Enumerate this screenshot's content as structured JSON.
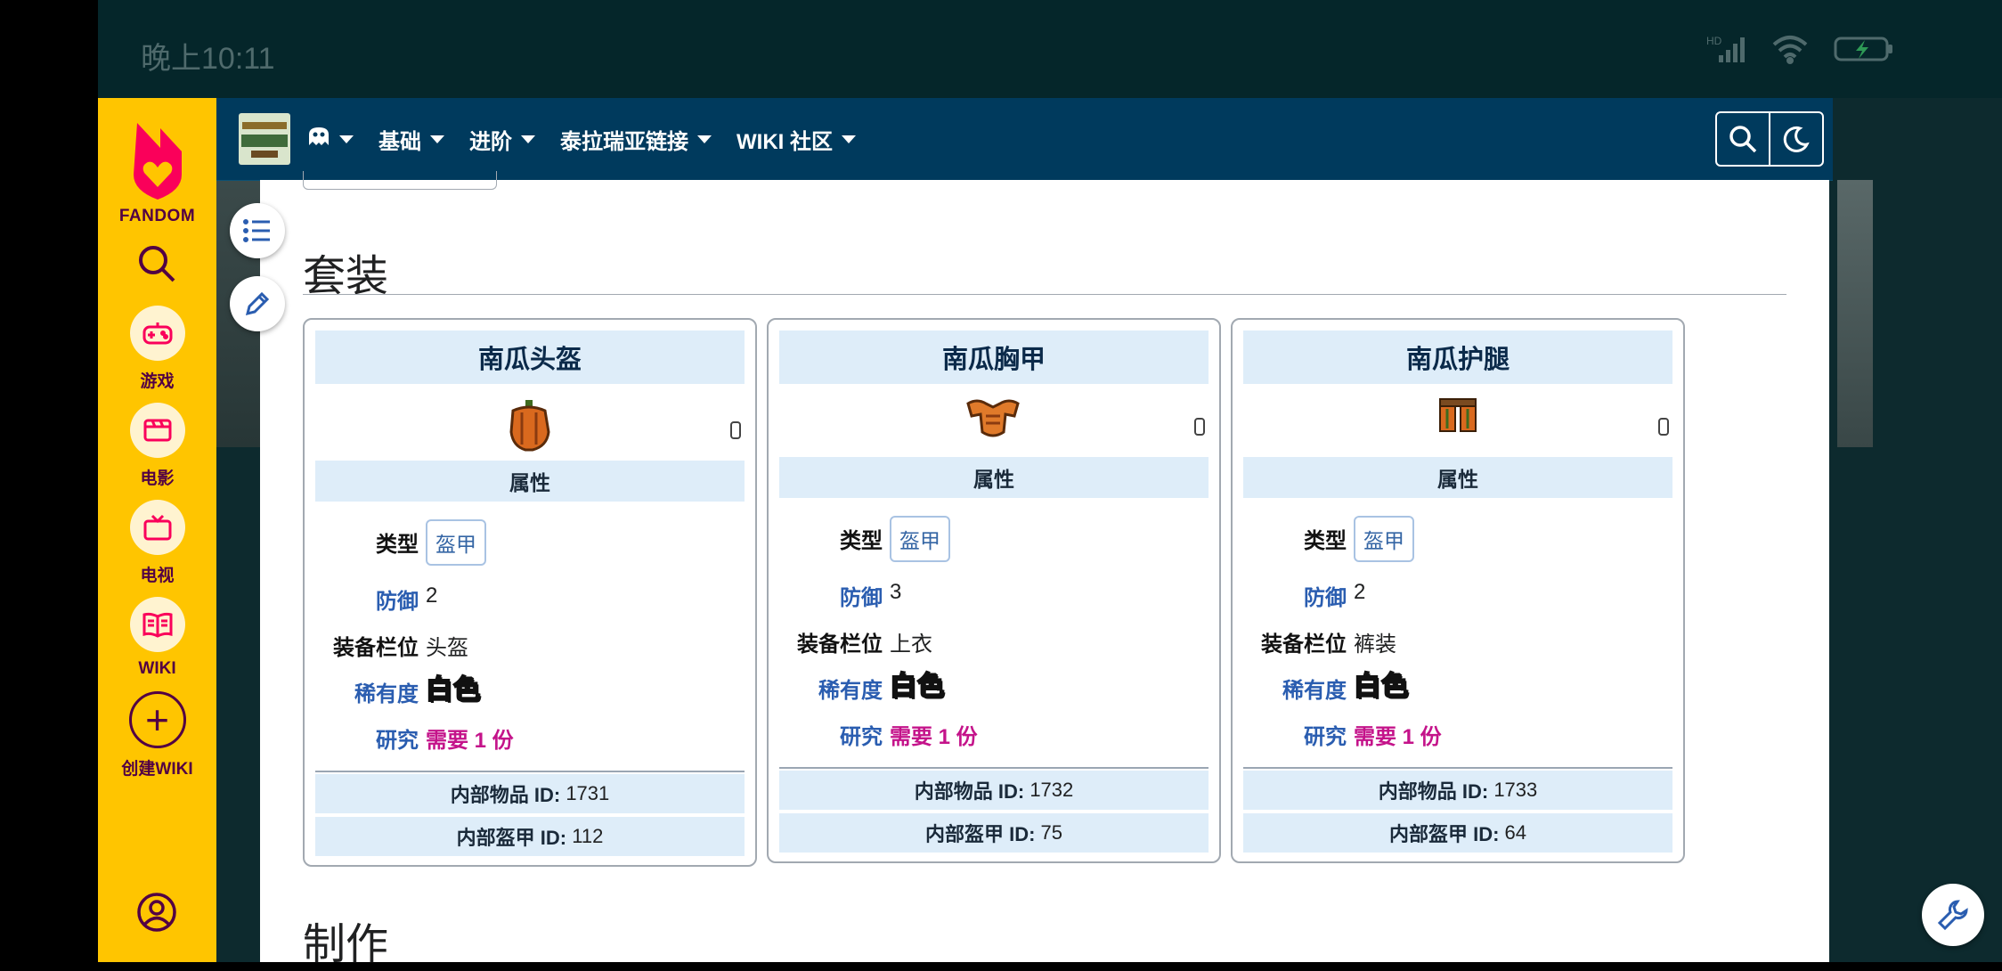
{
  "status": {
    "time": "晚上10:11",
    "network": "HD"
  },
  "fandom": {
    "brand": "FANDOM",
    "items": [
      {
        "label": "游戏"
      },
      {
        "label": "电影"
      },
      {
        "label": "电视"
      },
      {
        "label": "WIKI"
      },
      {
        "label": "创建WIKI"
      }
    ]
  },
  "nav": {
    "items": [
      "",
      "基础",
      "进阶",
      "泰拉瑞亚链接",
      "WIKI 社区"
    ]
  },
  "article": {
    "section_title": "套装",
    "next_section_title": "制作",
    "cards": [
      {
        "title": "南瓜头盔",
        "sprite": "pumpkin-helmet",
        "attr_header": "属性",
        "type_label": "类型",
        "type_value": "盔甲",
        "defense_label": "防御",
        "defense_value": "2",
        "slot_label": "装备栏位",
        "slot_value": "头盔",
        "rarity_label": "稀有度",
        "rarity_value": "白色",
        "research_label": "研究",
        "research_value": "需要 1 份",
        "item_id_label": "内部物品 ID:",
        "item_id": "1731",
        "armor_id_label": "内部盔甲 ID:",
        "armor_id": "112"
      },
      {
        "title": "南瓜胸甲",
        "sprite": "pumpkin-breastplate",
        "attr_header": "属性",
        "type_label": "类型",
        "type_value": "盔甲",
        "defense_label": "防御",
        "defense_value": "3",
        "slot_label": "装备栏位",
        "slot_value": "上衣",
        "rarity_label": "稀有度",
        "rarity_value": "白色",
        "research_label": "研究",
        "research_value": "需要 1 份",
        "item_id_label": "内部物品 ID:",
        "item_id": "1732",
        "armor_id_label": "内部盔甲 ID:",
        "armor_id": "75"
      },
      {
        "title": "南瓜护腿",
        "sprite": "pumpkin-leggings",
        "attr_header": "属性",
        "type_label": "类型",
        "type_value": "盔甲",
        "defense_label": "防御",
        "defense_value": "2",
        "slot_label": "装备栏位",
        "slot_value": "裤装",
        "rarity_label": "稀有度",
        "rarity_value": "白色",
        "research_label": "研究",
        "research_value": "需要 1 份",
        "item_id_label": "内部物品 ID:",
        "item_id": "1733",
        "armor_id_label": "内部盔甲 ID:",
        "armor_id": "64"
      }
    ]
  },
  "colors": {
    "fandom_yellow": "#ffc500",
    "nav_blue": "#003a5d",
    "header_light": "#deedf9",
    "link": "#2a5db0",
    "research": "#c4138a"
  }
}
